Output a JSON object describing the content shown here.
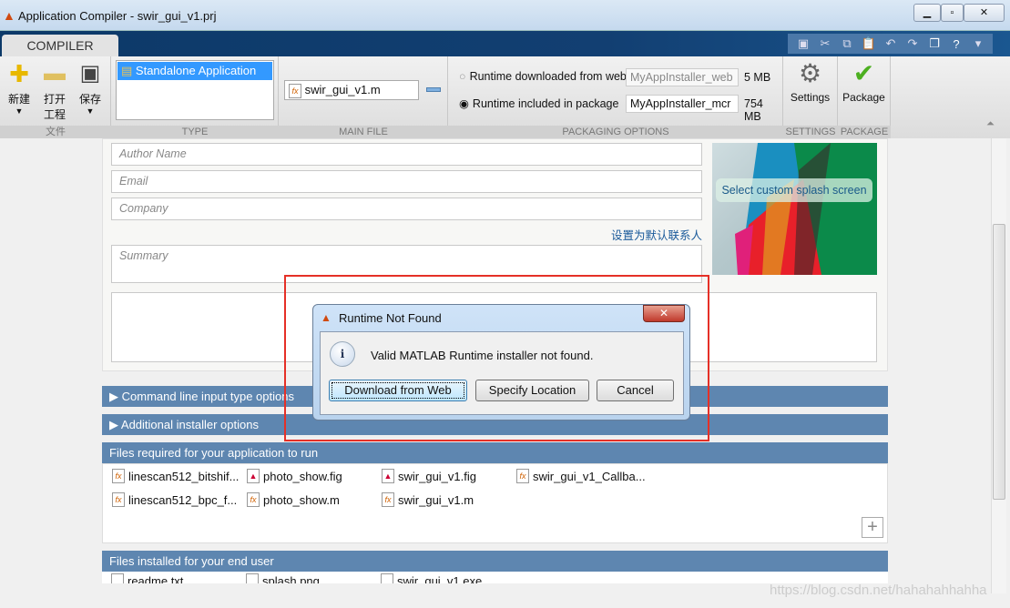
{
  "window": {
    "title": "Application Compiler - swir_gui_v1.prj"
  },
  "ribbon": {
    "tab": "COMPILER",
    "file": {
      "new": "新建",
      "open_line1": "打开",
      "open_line2": "工程",
      "save": "保存",
      "label": "文件"
    },
    "type": {
      "selected": "Standalone Application",
      "label": "TYPE"
    },
    "main_file": {
      "value": "swir_gui_v1.m",
      "label": "MAIN FILE"
    },
    "packaging": {
      "label": "PACKAGING OPTIONS",
      "options": [
        {
          "label": "Runtime downloaded from web",
          "name": "MyAppInstaller_web",
          "size": "5 MB",
          "selected": false
        },
        {
          "label": "Runtime included in package",
          "name": "MyAppInstaller_mcr",
          "size": "754 MB",
          "selected": true
        }
      ]
    },
    "settings": {
      "button": "Settings",
      "label": "SETTINGS"
    },
    "package": {
      "button": "Package",
      "label": "PACKAGE"
    }
  },
  "form": {
    "author_placeholder": "Author Name",
    "email_placeholder": "Email",
    "company_placeholder": "Company",
    "set_default_link": "设置为默认联系人",
    "summary_placeholder": "Summary",
    "splash_label": "Select custom splash screen"
  },
  "sections": {
    "command_line": "Command line input type options",
    "additional": "Additional installer options",
    "files_required": "Files required for your application to run",
    "files_installed": "Files installed for your end user"
  },
  "files_required": [
    "linescan512_bitshif...",
    "photo_show.fig",
    "swir_gui_v1.fig",
    "swir_gui_v1_Callba...",
    "linescan512_bpc_f...",
    "photo_show.m",
    "swir_gui_v1.m"
  ],
  "files_installed": [
    "readme.txt",
    "splash.png",
    "swir_gui_v1.exe"
  ],
  "dialog": {
    "title": "Runtime Not Found",
    "message": "Valid MATLAB Runtime installer not found.",
    "buttons": [
      "Download from Web",
      "Specify Location",
      "Cancel"
    ]
  },
  "watermark": "https://blog.csdn.net/hahahahhahha",
  "colors": {
    "section_bar": "#5e86b0",
    "highlight": "#e53027",
    "selection": "#3399ff"
  }
}
